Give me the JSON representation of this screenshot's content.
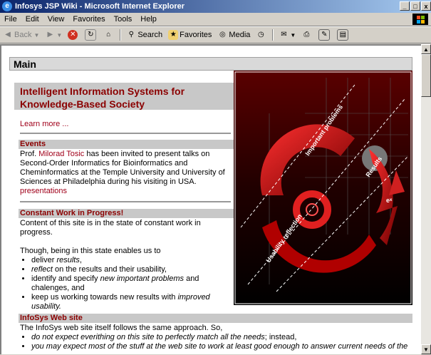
{
  "window": {
    "title": "Infosys JSP Wiki - Microsoft Internet Explorer",
    "controls": [
      "_",
      "□",
      "x"
    ]
  },
  "menu": [
    "File",
    "Edit",
    "View",
    "Favorites",
    "Tools",
    "Help"
  ],
  "toolbar": {
    "back": "Back",
    "search": "Search",
    "favorites": "Favorites",
    "media": "Media"
  },
  "page": {
    "main_title": "Main",
    "banner": "Intelligent Information Systems for Knowledge-Based Society",
    "learn_more": "Learn more ...",
    "events": {
      "heading": "Events",
      "prefix": "Prof. ",
      "person": "Milorad Tosic",
      "text": " has been invited to present talks on Second-Order Informatics for Bioinformatics and Cheminformatics at the Temple University and University of Sciences at Philadelphia during his visiting in USA.",
      "link": "presentations"
    },
    "progress": {
      "heading": "Constant Work in Progress!",
      "intro": "Content of this site is in the state of constant work in progress.",
      "lead": "Though, being in this state enables us to",
      "items": [
        {
          "em": "",
          "pre": "deliver ",
          "it": "results",
          "post": ","
        },
        {
          "pre": "",
          "it": "reflect",
          "post": " on the results and their usability,"
        },
        {
          "pre": "identify and specify ",
          "it": "new important problems",
          "post": " and chalenges, and"
        },
        {
          "pre": "keep us working towards new results with ",
          "it": "improved usability.",
          "post": ""
        }
      ]
    },
    "infosys": {
      "heading": "InfoSys Web site",
      "lead": "The InfoSys web site itself follows the same approach. So,",
      "items": [
        {
          "it": "do not expect everithing on this site to perfectly match all the needs",
          "post": "; instead,"
        },
        {
          "it": "you may expect most of the stuff at the web site to work at least good enough to answer current needs of the",
          "post": ""
        }
      ]
    },
    "image_labels": {
      "a": "Important problems",
      "b": "Results",
      "c": "Usability reflection",
      "d": "eˣ"
    }
  }
}
